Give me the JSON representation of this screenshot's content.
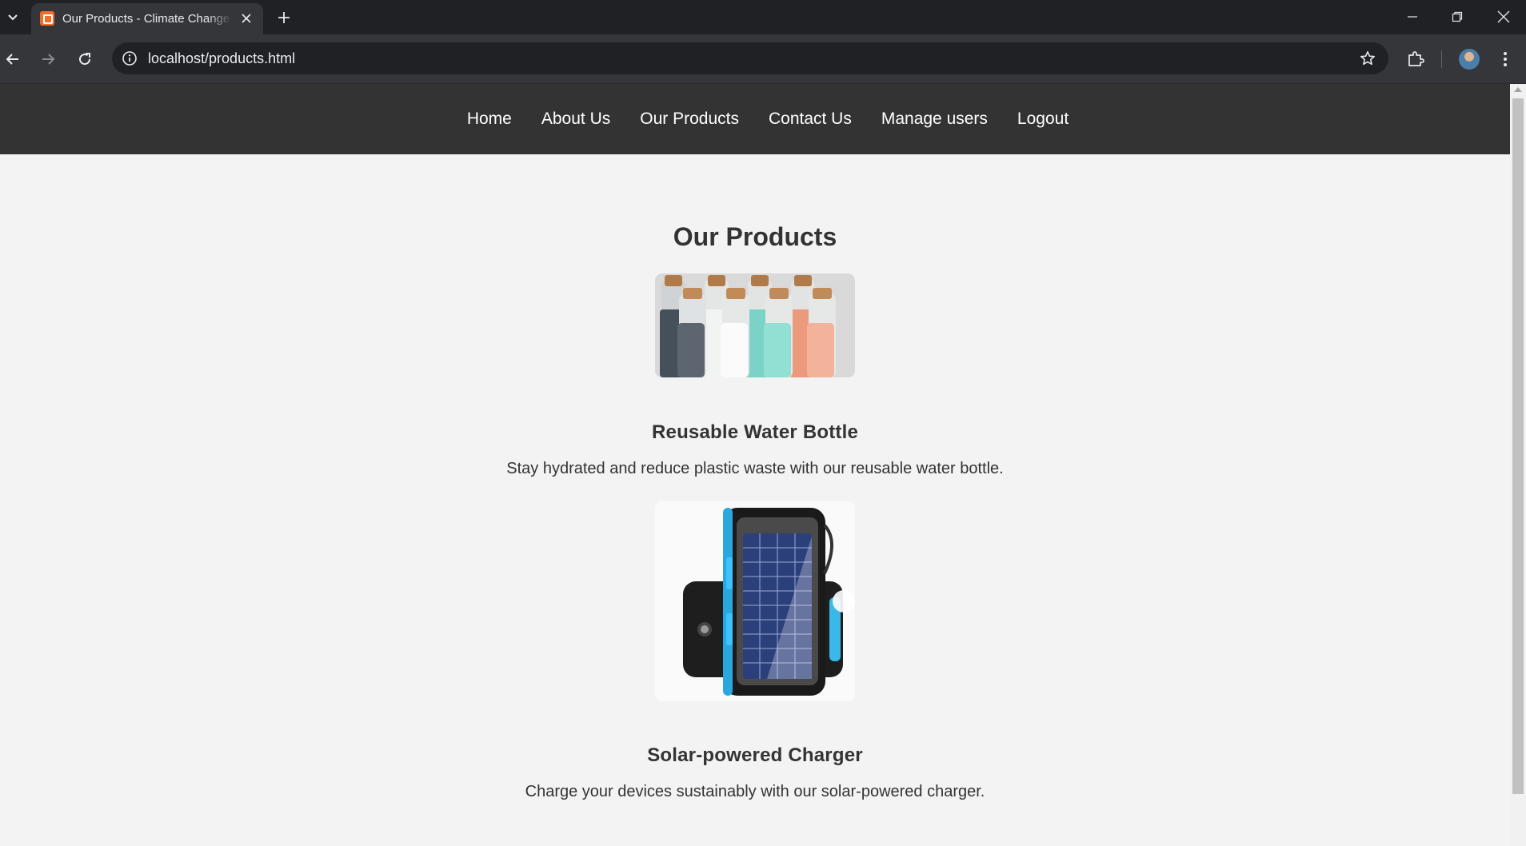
{
  "browser": {
    "tab_title": "Our Products - Climate Change",
    "url": "localhost/products.html",
    "icons": [
      "tab-list-icon",
      "favicon-icon",
      "close-icon",
      "plus-icon",
      "minimize-icon",
      "restore-icon",
      "window-close-icon",
      "back-icon",
      "forward-icon",
      "reload-icon",
      "info-icon",
      "star-icon",
      "extensions-icon",
      "avatar",
      "menu-icon"
    ]
  },
  "nav": {
    "items": [
      "Home",
      "About Us",
      "Our Products",
      "Contact Us",
      "Manage users",
      "Logout"
    ]
  },
  "page": {
    "title": "Our Products",
    "products": [
      {
        "name": "Reusable Water Bottle",
        "description": "Stay hydrated and reduce plastic waste with our reusable water bottle.",
        "image": "water-bottles-image"
      },
      {
        "name": "Solar-powered Charger",
        "description": "Charge your devices sustainably with our solar-powered charger.",
        "image": "solar-charger-image"
      }
    ]
  },
  "colors": {
    "nav_bg": "#333333",
    "page_bg": "#f3f3f3",
    "text": "#333333",
    "chrome_dark": "#202124",
    "chrome_toolbar": "#35363a"
  }
}
